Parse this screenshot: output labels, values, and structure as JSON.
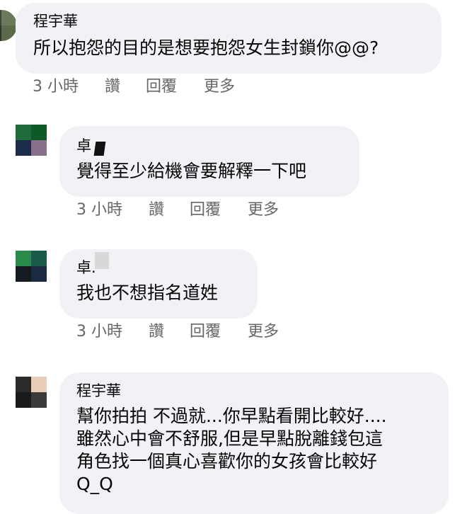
{
  "comments": [
    {
      "author": "程宇華",
      "text": "所以抱怨的目的是想要抱怨女生封鎖你@@?",
      "time": "3 小時",
      "like": "讚",
      "reply": "回覆",
      "more": "更多",
      "avatar_colors": [
        "#3a4a3a",
        "#6a7a5a",
        "#2a3a2a",
        "#5a6a4a"
      ]
    },
    {
      "author": "卓",
      "text": "覺得至少給機會要解釋一下吧",
      "time": "3 小時",
      "like": "讚",
      "reply": "回覆",
      "more": "更多",
      "avatar_colors": [
        "#1f6b3a",
        "#0e5a26",
        "#1e2a4a",
        "#8a6f8a"
      ]
    },
    {
      "author": "卓.",
      "text": "我也不想指名道姓",
      "time": "3 小時",
      "like": "讚",
      "reply": "回覆",
      "more": "更多",
      "avatar_colors": [
        "#2a8a4a",
        "#1a5a4a",
        "#151a20",
        "#1a2a40"
      ]
    },
    {
      "author": "程宇華",
      "text": "幫你拍拍 不過就...你早點看開比較好....\n雖然心中會不舒服,但是早點脫離錢包這\n角色找一個真心喜歡你的女孩會比較好\nQ_Q",
      "time": "",
      "like": "",
      "reply": "",
      "more": "",
      "avatar_colors": [
        "#2a2a2a",
        "#e8cdb8",
        "#1a1a1a",
        "#3a3a3a"
      ]
    }
  ]
}
